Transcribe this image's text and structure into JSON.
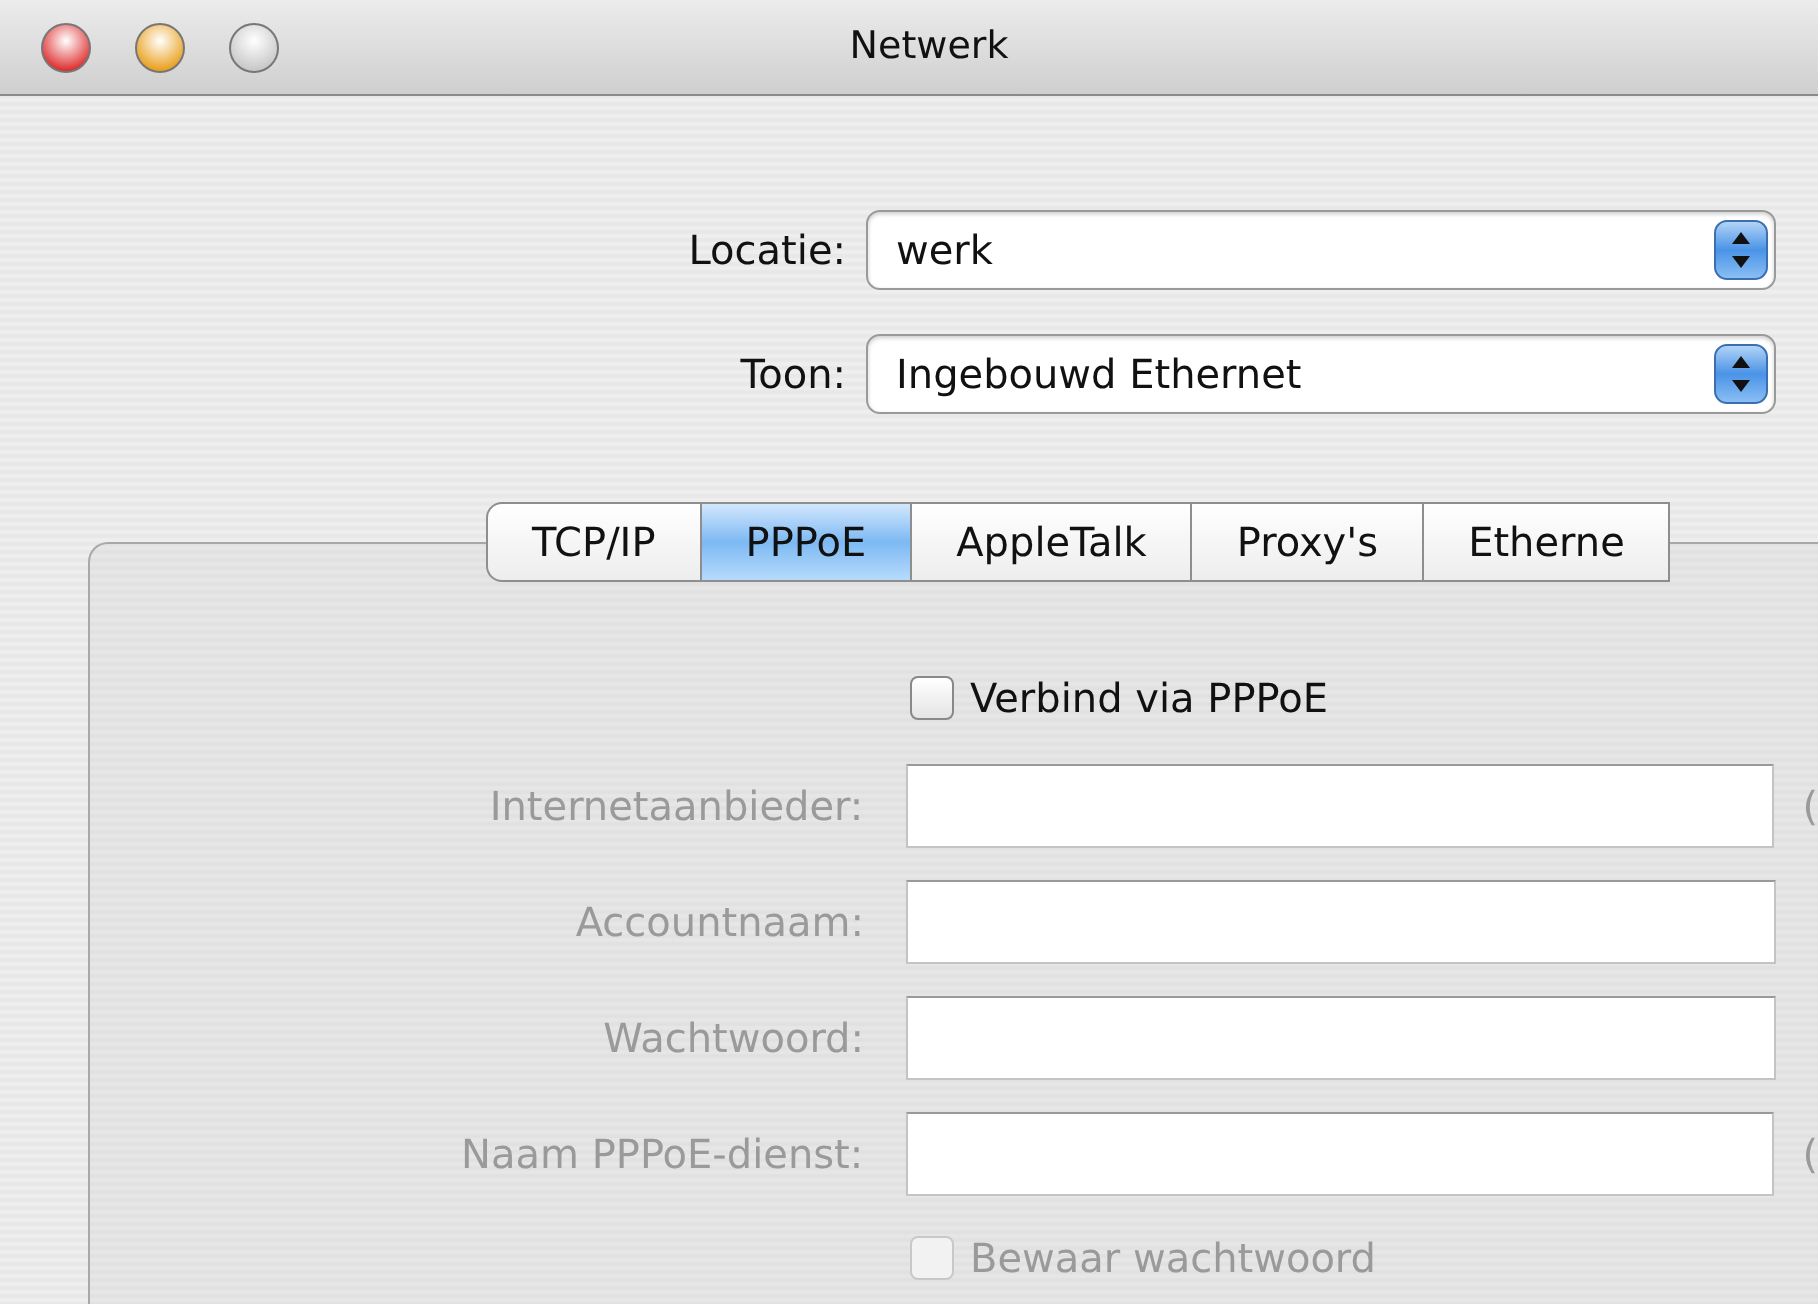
{
  "window": {
    "title": "Netwerk"
  },
  "popups": [
    {
      "label": "Locatie:",
      "value": "werk"
    },
    {
      "label": "Toon:",
      "value": "Ingebouwd Ethernet"
    }
  ],
  "tabs": [
    {
      "label": "TCP/IP",
      "selected": false
    },
    {
      "label": "PPPoE",
      "selected": true
    },
    {
      "label": "AppleTalk",
      "selected": false
    },
    {
      "label": "Proxy's",
      "selected": false
    },
    {
      "label": "Etherne",
      "selected": false
    }
  ],
  "connect_checkbox": {
    "label": "Verbind via PPPoE",
    "checked": false,
    "disabled": false
  },
  "fields": [
    {
      "label": "Internetaanbieder:",
      "disabled": true,
      "suffix": "("
    },
    {
      "label": "Accountnaam:",
      "disabled": true
    },
    {
      "label": "Wachtwoord:",
      "disabled": true
    },
    {
      "label": "Naam PPPoE-dienst:",
      "disabled": true,
      "suffix": "("
    }
  ],
  "save_checkbox": {
    "label": "Bewaar wachtwoord",
    "checked": false,
    "disabled": true
  }
}
